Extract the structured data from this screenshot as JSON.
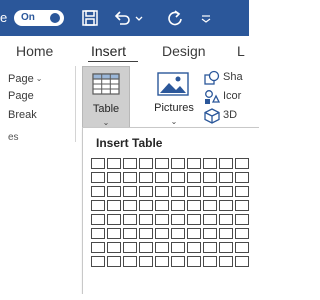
{
  "titlebar": {
    "autosave_fragment": "e",
    "autosave_state": "On",
    "icons": [
      "save-icon",
      "undo-icon",
      "undo-dropdown-icon",
      "redo-icon",
      "customize-qat-icon"
    ]
  },
  "tabs": {
    "home": "Home",
    "insert": "Insert",
    "design": "Design",
    "layout": "L"
  },
  "pages_group": {
    "cover": "Page",
    "blank": "Page",
    "break": "Break",
    "label": "es"
  },
  "table_button": {
    "label": "Table",
    "caret": "⌄"
  },
  "pictures_button": {
    "label": "Pictures",
    "caret": "⌄"
  },
  "illustrations": {
    "shapes": "Sha",
    "icons": "Icor",
    "models": "3D"
  },
  "insert_table": {
    "title": "Insert Table",
    "columns": 10,
    "rows": 8
  },
  "colors": {
    "titlebar": "#2b579a",
    "selected_button": "#cfcfcf",
    "icon_blue": "#2b579a"
  }
}
